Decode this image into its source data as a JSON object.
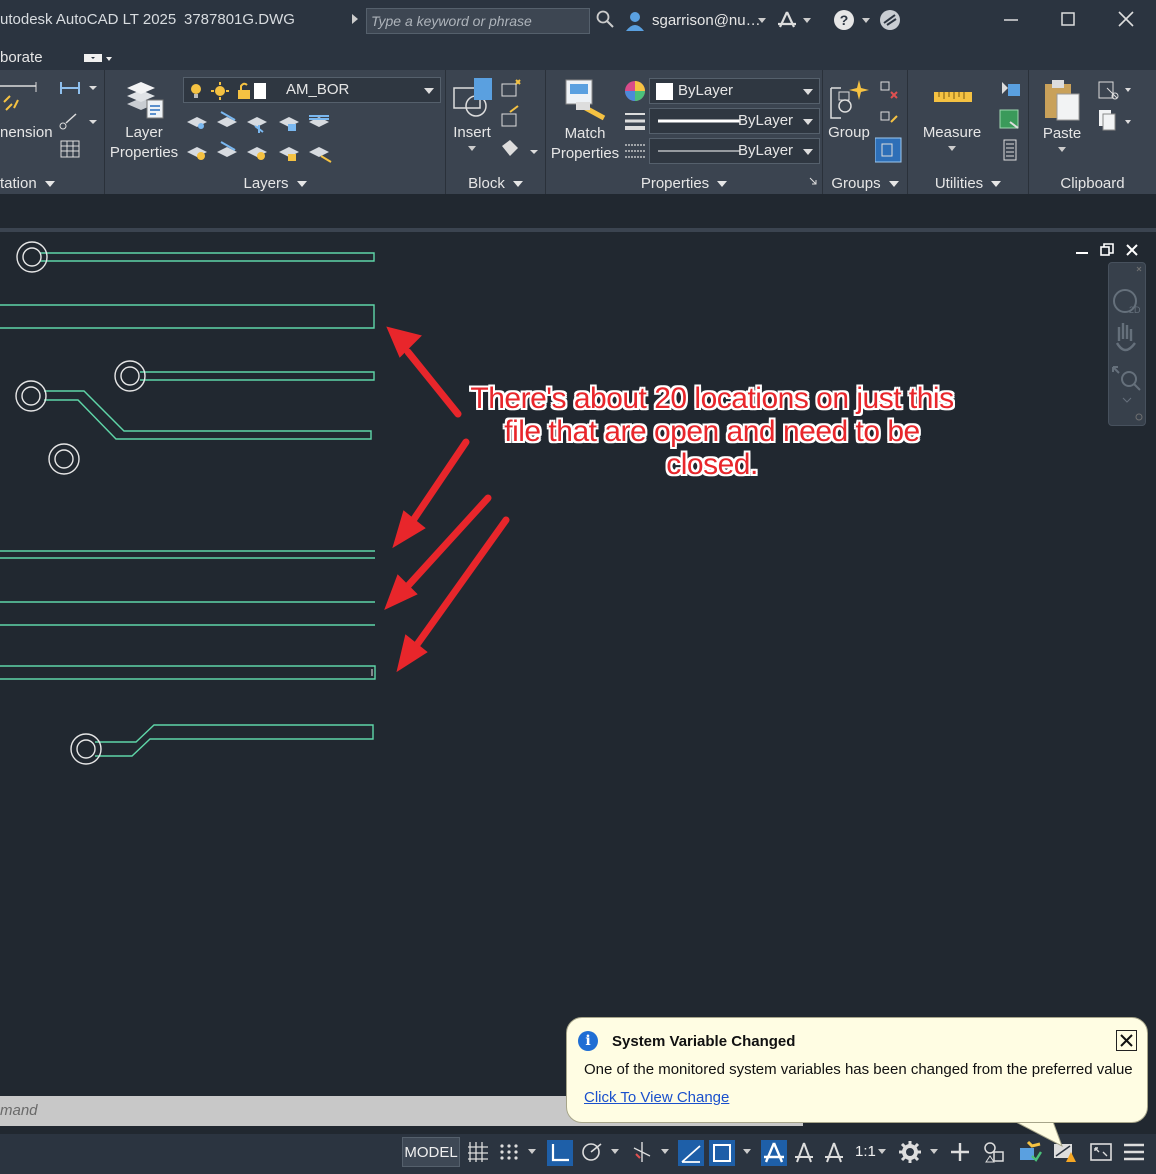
{
  "window": {
    "app_title": "utodesk AutoCAD LT 2025",
    "file_name": "3787801G.DWG",
    "search_placeholder": "Type a keyword or phrase",
    "user": "sgarrison@nu…"
  },
  "tabs": {
    "visible_tab": "borate"
  },
  "ribbon": {
    "annotation": {
      "dimension_label": "nension",
      "panel_title": "tation"
    },
    "layers": {
      "button_label_1": "Layer",
      "button_label_2": "Properties",
      "current_layer": "AM_BOR",
      "panel_title": "Layers"
    },
    "block": {
      "insert_label": "Insert",
      "panel_title": "Block"
    },
    "properties": {
      "match_label_1": "Match",
      "match_label_2": "Properties",
      "color": "ByLayer",
      "linetype": "ByLayer",
      "lineweight": "ByLayer",
      "panel_title": "Properties"
    },
    "groups": {
      "group_label": "Group",
      "panel_title": "Groups"
    },
    "utilities": {
      "measure_label": "Measure",
      "panel_title": "Utilities"
    },
    "clipboard": {
      "paste_label": "Paste",
      "panel_title": "Clipboard"
    }
  },
  "annotation_text": {
    "line1": "There's about 20 locations on just this",
    "line2": "file that are open and need to be",
    "line3": "closed."
  },
  "command_line": {
    "placeholder": "mand"
  },
  "status_bar": {
    "model": "MODEL",
    "scale": "1:1"
  },
  "notification": {
    "title": "System Variable Changed",
    "message": "One of the monitored system variables has been changed from the preferred value",
    "link": "Click To View Change"
  },
  "colors": {
    "drawing_background": "#212830",
    "geometry": "#5fd6a8",
    "circles": "#e6e6e6",
    "arrow": "#e8262b",
    "ribbon": "#3b4450"
  }
}
